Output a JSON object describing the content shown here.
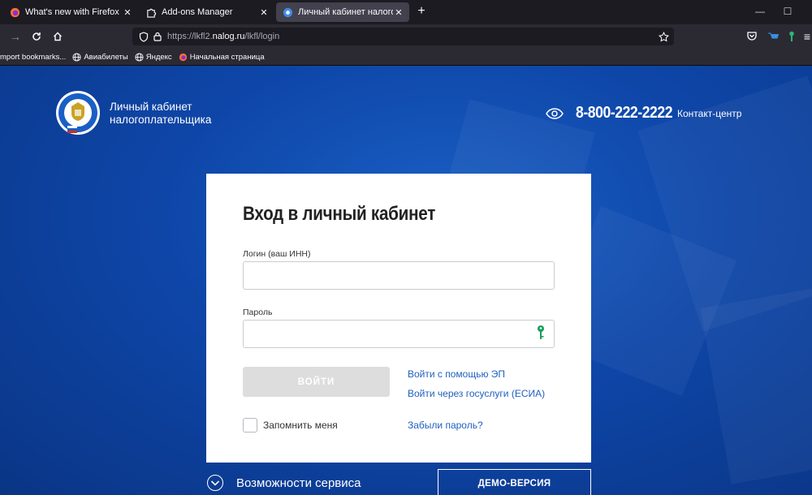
{
  "browser": {
    "tabs": [
      {
        "title": "What's new with Firefox - More",
        "active": false
      },
      {
        "title": "Add-ons Manager",
        "active": false
      },
      {
        "title": "Личный кабинет налогоплате",
        "active": true
      }
    ],
    "tab_close": "✕",
    "new_tab": "+",
    "url_prefix": "https://lkfl2.",
    "url_domain": "nalog.ru",
    "url_path": "/lkfl/login",
    "bookmarks": [
      {
        "label": "mport bookmarks...",
        "icon": "import-icon"
      },
      {
        "label": "Авиабилеты",
        "icon": "globe-icon"
      },
      {
        "label": "Яндекс",
        "icon": "globe-icon"
      },
      {
        "label": "Начальная страница",
        "icon": "firefox-icon"
      }
    ]
  },
  "header": {
    "brand_line1": "Личный кабинет",
    "brand_line2": "налогоплательщика",
    "phone": "8-800-222-2222",
    "contact_label": "Контакт-центр"
  },
  "login": {
    "title": "Вход в личный кабинет",
    "login_label": "Логин (ваш ИНН)",
    "login_value": "",
    "password_label": "Пароль",
    "password_value": "",
    "submit_label": "ВОЙТИ",
    "ep_link": "Войти с помощью ЭП",
    "esia_link": "Войти через госуслуги (ЕСИА)",
    "remember_label": "Запомнить меня",
    "remember_checked": false,
    "forgot_link": "Забыли пароль?"
  },
  "footer": {
    "features_label": "Возможности сервиса",
    "demo_label": "ДЕМО-ВЕРСИЯ"
  },
  "colors": {
    "accent": "#0e46a8",
    "link": "#1f5fbf",
    "button_disabled": "#dddddd"
  }
}
